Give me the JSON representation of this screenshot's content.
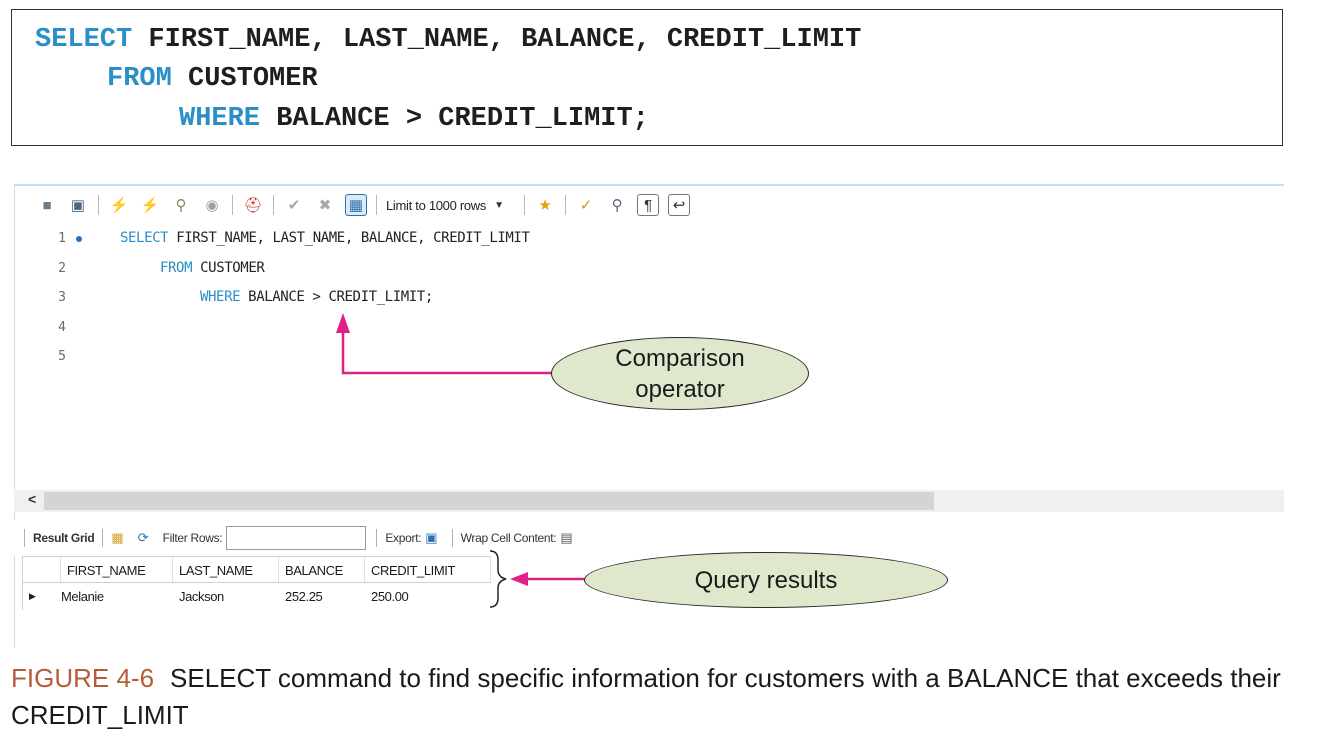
{
  "code_box": {
    "line1_kw": "SELECT",
    "line1_rest": " FIRST_NAME, LAST_NAME, BALANCE, CREDIT_LIMIT",
    "line2_kw": "FROM",
    "line2_rest": " CUSTOMER",
    "line3_kw": "WHERE",
    "line3_rest": " BALANCE > CREDIT_LIMIT;"
  },
  "toolbar": {
    "limit_label": "Limit to 1000 rows",
    "icons": [
      "folder-icon",
      "save-icon",
      "execute-icon",
      "execute-current-icon",
      "explain-icon",
      "stop-icon",
      "toggle-error-icon",
      "commit-icon",
      "rollback-icon",
      "autocommit-icon",
      "dropdown-icon",
      "beautify-icon",
      "cleanup-icon",
      "find-icon",
      "invisible-chars-icon",
      "wrap-icon"
    ]
  },
  "editor": {
    "line_numbers": [
      "1",
      "2",
      "3",
      "4",
      "5"
    ],
    "line1_kw": "SELECT",
    "line1_rest": " FIRST_NAME, LAST_NAME, BALANCE, CREDIT_LIMIT",
    "line2_kw": "FROM",
    "line2_rest": " CUSTOMER",
    "line3_kw": "WHERE",
    "line3_rest": " BALANCE > CREDIT_LIMIT;"
  },
  "result_bar": {
    "result_grid_label": "Result Grid",
    "filter_rows_label": "Filter Rows:",
    "export_label": "Export:",
    "wrap_label": "Wrap Cell Content:"
  },
  "grid": {
    "columns": [
      "FIRST_NAME",
      "LAST_NAME",
      "BALANCE",
      "CREDIT_LIMIT"
    ],
    "rows": [
      [
        "Melanie",
        "Jackson",
        "252.25",
        "250.00"
      ]
    ]
  },
  "callouts": {
    "comparison_line1": "Comparison",
    "comparison_line2": "operator",
    "query_results": "Query results"
  },
  "colors": {
    "keyword": "#2a8fc7",
    "arrow": "#e0218a",
    "callout_fill": "#dfe8cc",
    "figure_label": "#b65b3a"
  },
  "caption": {
    "label": "FIGURE 4-6",
    "text": "SELECT command to find specific information for customers with a BALANCE that exceeds their CREDIT_LIMIT"
  }
}
